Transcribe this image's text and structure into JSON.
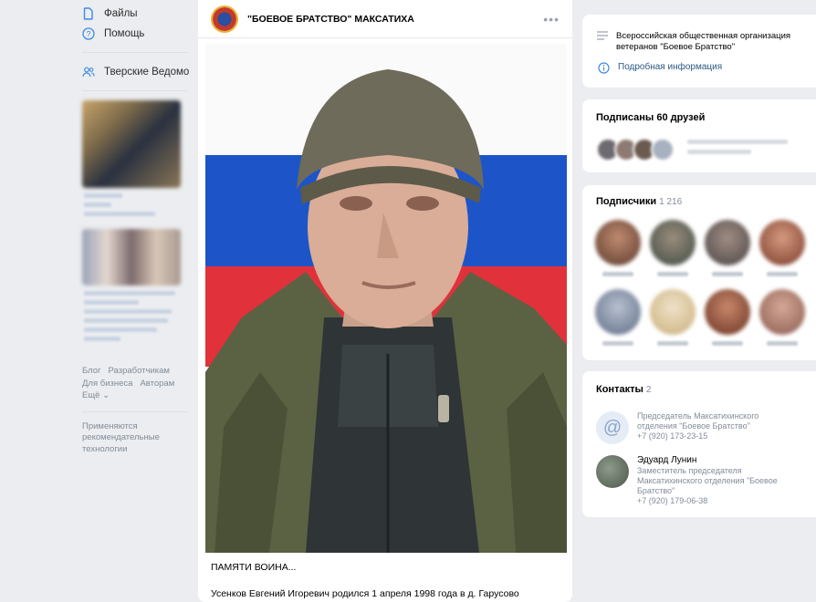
{
  "left_nav": {
    "items": [
      {
        "label": "Файлы",
        "icon": "file-icon"
      },
      {
        "label": "Помощь",
        "icon": "help-icon"
      }
    ],
    "group_link": {
      "label": "Тверские Ведомо...",
      "icon": "people-icon"
    },
    "footer_links": [
      "Блог",
      "Разработчикам",
      "Для бизнеса",
      "Авторам",
      "Ещё ⌄"
    ],
    "footer_note": "Применяются рекомендательные технологии"
  },
  "post": {
    "author": "\"БОЕВОЕ БРАТСТВО\" МАКСАТИХА",
    "more_icon": "ellipsis-icon",
    "caption_title": "ПАМЯТИ ВОИНА...",
    "caption_text": "Усенков Евгений Игоревич родился 1 апреля 1998 года в д. Гарусово"
  },
  "info": {
    "description": "Всероссийская общественная организация ветеранов \"Боевое Братство\"",
    "more_link": "Подробная информация"
  },
  "friends": {
    "title": "Подписаны 60 друзей"
  },
  "subscribers": {
    "title": "Подписчики",
    "count": "1 216"
  },
  "contacts": {
    "title": "Контакты",
    "count": "2",
    "items": [
      {
        "name": "",
        "role": "Председатель Максатихинского отделения \"Боевое Братство\"",
        "phone": "+7 (920) 173-23-15"
      },
      {
        "name": "Эдуард Лунин",
        "role": "Заместитель председателя Максатихинского отделения \"Боевое Братство\"",
        "phone": "+7 (920) 179-06-38"
      }
    ]
  },
  "colors": {
    "accent": "#2a5885",
    "link_icon": "#3f8ae0",
    "background": "#ebedf0"
  }
}
